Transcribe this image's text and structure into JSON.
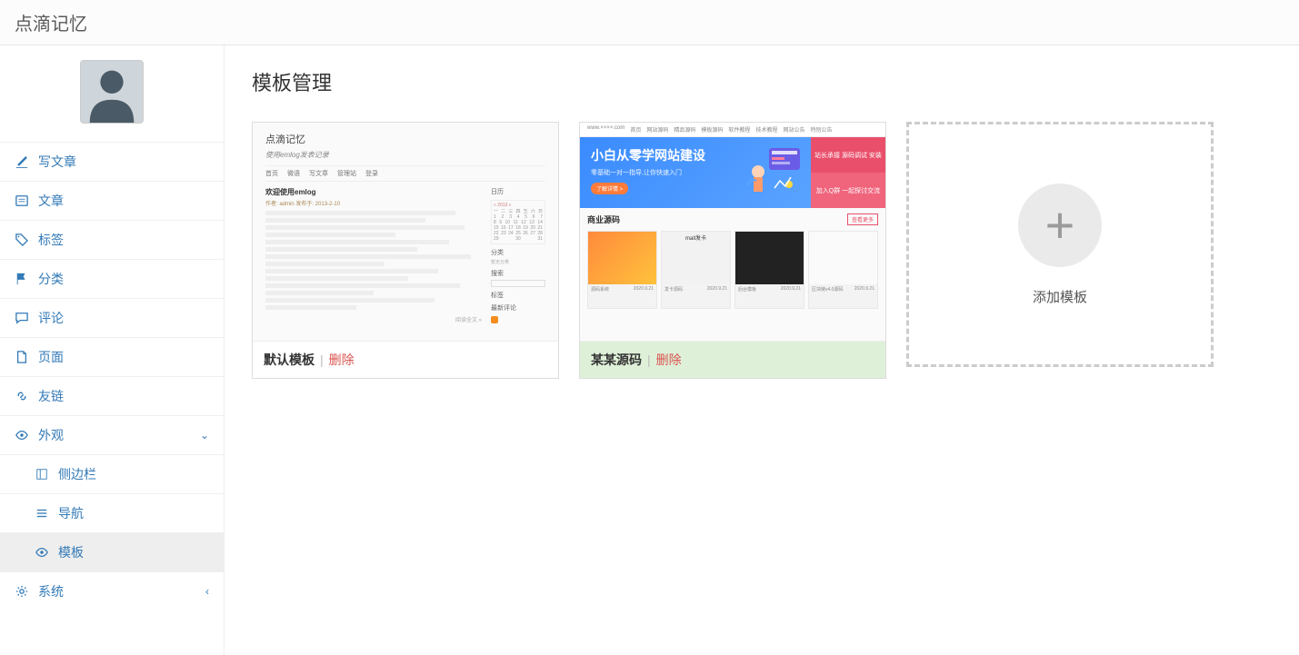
{
  "app_title": "点滴记忆",
  "page_title": "模板管理",
  "nav": {
    "write": "写文章",
    "posts": "文章",
    "tags": "标签",
    "categories": "分类",
    "comments": "评论",
    "pages": "页面",
    "links": "友链",
    "appearance": "外观",
    "system": "系统"
  },
  "subnav": {
    "sidebar": "侧边栏",
    "navigation": "导航",
    "template": "模板"
  },
  "templates": [
    {
      "name": "默认模板",
      "delete": "删除",
      "active": false
    },
    {
      "name": "某某源码",
      "delete": "删除",
      "active": true
    }
  ],
  "add_template": "添加模板",
  "thumb1": {
    "site": "点滴记忆",
    "tagline": "使用emlog发表记录",
    "menu": [
      "首页",
      "微语",
      "写文章",
      "管理站",
      "登录"
    ],
    "post_title": "欢迎使用emlog",
    "meta": "作者: admin 发布于: 2013-2-10 ",
    "side_cal": "日历",
    "side_cat": "分类",
    "side_search": "搜索",
    "side_tag": "标签",
    "side_rss": "最新评论"
  },
  "thumb2": {
    "topnav": [
      "www.××××.com",
      "首页",
      "网站源码",
      "精品源码",
      "模板源码",
      "软件教程",
      "技术教程",
      "网站公告",
      "特别公告"
    ],
    "hero_big": "小白从零学网站建设",
    "hero_sm": "零基础一对一指导,让你快速入门",
    "hero_btn": "了解详情 >",
    "right1": "站长承接\n源码调试 安装",
    "right2": "加入Q群\n一起探讨交流",
    "section": "商业源码",
    "more": "查看更多",
    "date": "2020.9.21",
    "tile_caption": "mall发卡"
  }
}
